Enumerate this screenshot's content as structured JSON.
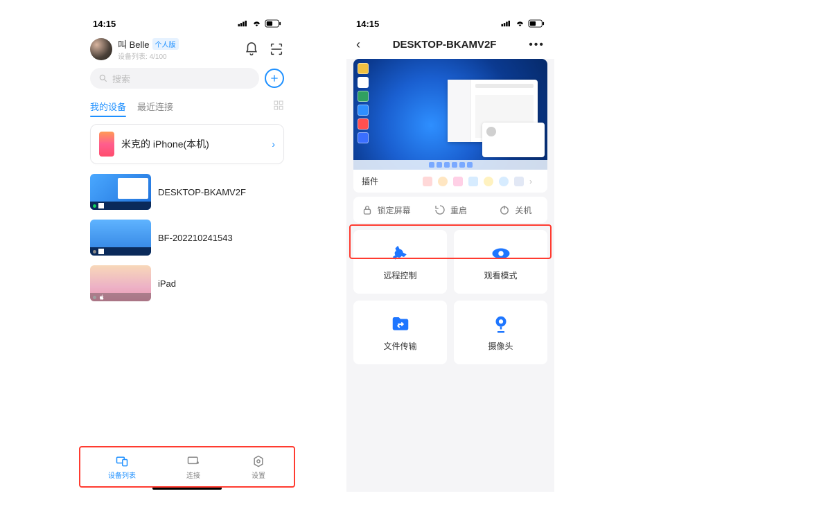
{
  "left": {
    "status": {
      "time": "14:15"
    },
    "user": {
      "name": "叫 Belle",
      "badge": "个人版",
      "sub_label": "设备列表:",
      "sub_value": "4/100"
    },
    "search_placeholder": "搜索",
    "tabs": {
      "my_devices": "我的设备",
      "recent": "最近连接"
    },
    "local_device": "米克的 iPhone(本机)",
    "devices": [
      "DESKTOP-BKAMV2F",
      "BF-202210241543",
      "iPad"
    ],
    "nav": {
      "list": "设备列表",
      "connect": "连接",
      "settings": "设置"
    }
  },
  "right": {
    "status": {
      "time": "14:15"
    },
    "title": "DESKTOP-BKAMV2F",
    "plugins_label": "插件",
    "actions": {
      "lock": "锁定屏幕",
      "restart": "重启",
      "shutdown": "关机"
    },
    "grid": {
      "remote": "远程控制",
      "watch": "观看模式",
      "file": "文件传输",
      "camera": "摄像头"
    }
  }
}
